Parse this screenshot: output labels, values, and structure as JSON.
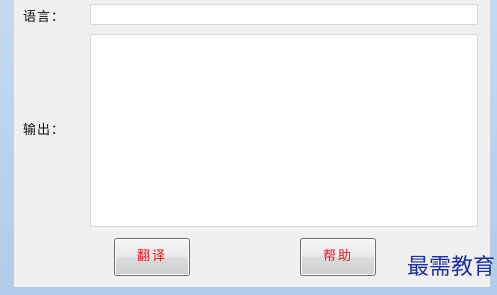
{
  "form": {
    "language_label": "语言：",
    "language_value": "",
    "output_label": "输出：",
    "output_value": ""
  },
  "buttons": {
    "translate_label": "翻译",
    "help_label": "帮助"
  },
  "watermark": {
    "text": "最需教育"
  },
  "colors": {
    "button_text": "#e8141e",
    "watermark": "#1c2fa6",
    "window_frame": "#b9d1ea"
  }
}
